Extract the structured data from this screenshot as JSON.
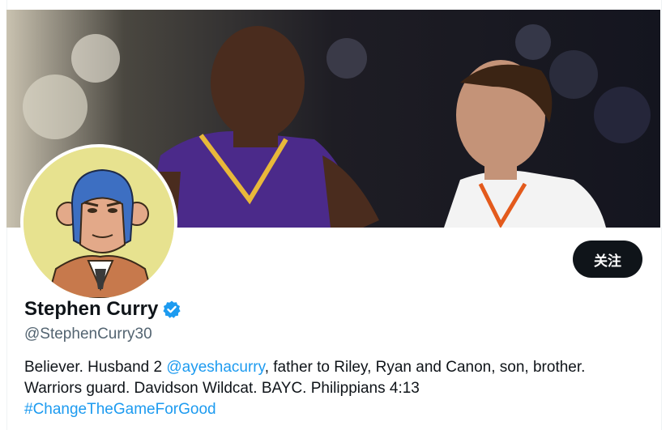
{
  "profile": {
    "display_name": "Stephen Curry",
    "handle": "@StephenCurry30",
    "verified": true,
    "verified_icon": "verified-badge-icon",
    "follow_label": "关注",
    "bio": {
      "part1": "Believer. Husband 2 ",
      "mention": "@ayeshacurry",
      "part2": ", father to Riley, Ryan and Canon, son, brother.",
      "line2": "Warriors guard. Davidson Wildcat. BAYC. Philippians 4:13",
      "hashtag": "#ChangeTheGameForGood"
    }
  },
  "colors": {
    "link": "#1d9bf0",
    "text": "#0f1419",
    "muted": "#536471",
    "verified": "#1d9bf0",
    "button": "#0f1419"
  }
}
